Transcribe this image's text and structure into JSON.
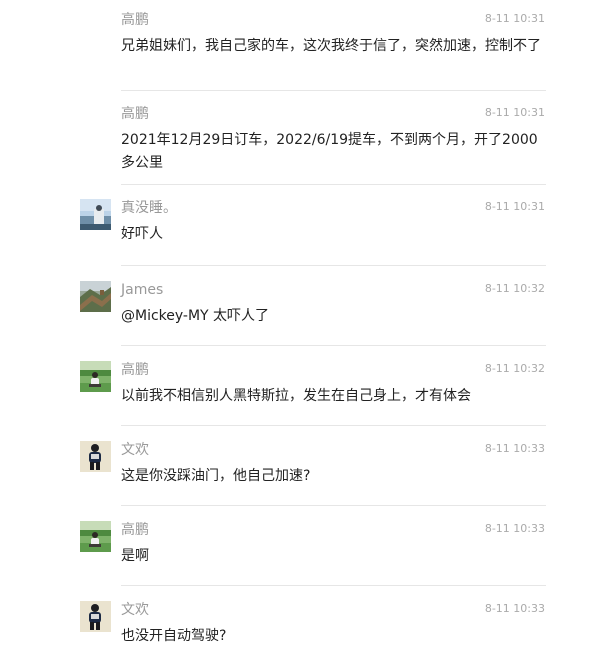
{
  "comments": [
    {
      "user": "高鹏",
      "time": "8-11 10:31",
      "text": "兄弟姐妹们，我自己家的车，这次我终于信了，突然加速，控制不了",
      "avatar": "none"
    },
    {
      "user": "高鹏",
      "time": "8-11 10:31",
      "text": "2021年12月29日订车，2022/6/19提车，不到两个月，开了2000多公里",
      "avatar": "none"
    },
    {
      "user": "真没睡。",
      "time": "8-11 10:31",
      "text": "好吓人",
      "avatar": "sky-lake"
    },
    {
      "user": "James",
      "time": "8-11 10:32",
      "text": "@Mickey-MY 太吓人了",
      "avatar": "great-wall"
    },
    {
      "user": "高鹏",
      "time": "8-11 10:32",
      "text": "以前我不相信别人黑特斯拉，发生在自己身上，才有体会",
      "avatar": "grass-person"
    },
    {
      "user": "文欢",
      "time": "8-11 10:33",
      "text": "这是你没踩油门，他自己加速?",
      "avatar": "person-portrait"
    },
    {
      "user": "高鹏",
      "time": "8-11 10:33",
      "text": "是啊",
      "avatar": "grass-person"
    },
    {
      "user": "文欢",
      "time": "8-11 10:33",
      "text": "也没开自动驾驶?",
      "avatar": "person-portrait"
    }
  ]
}
